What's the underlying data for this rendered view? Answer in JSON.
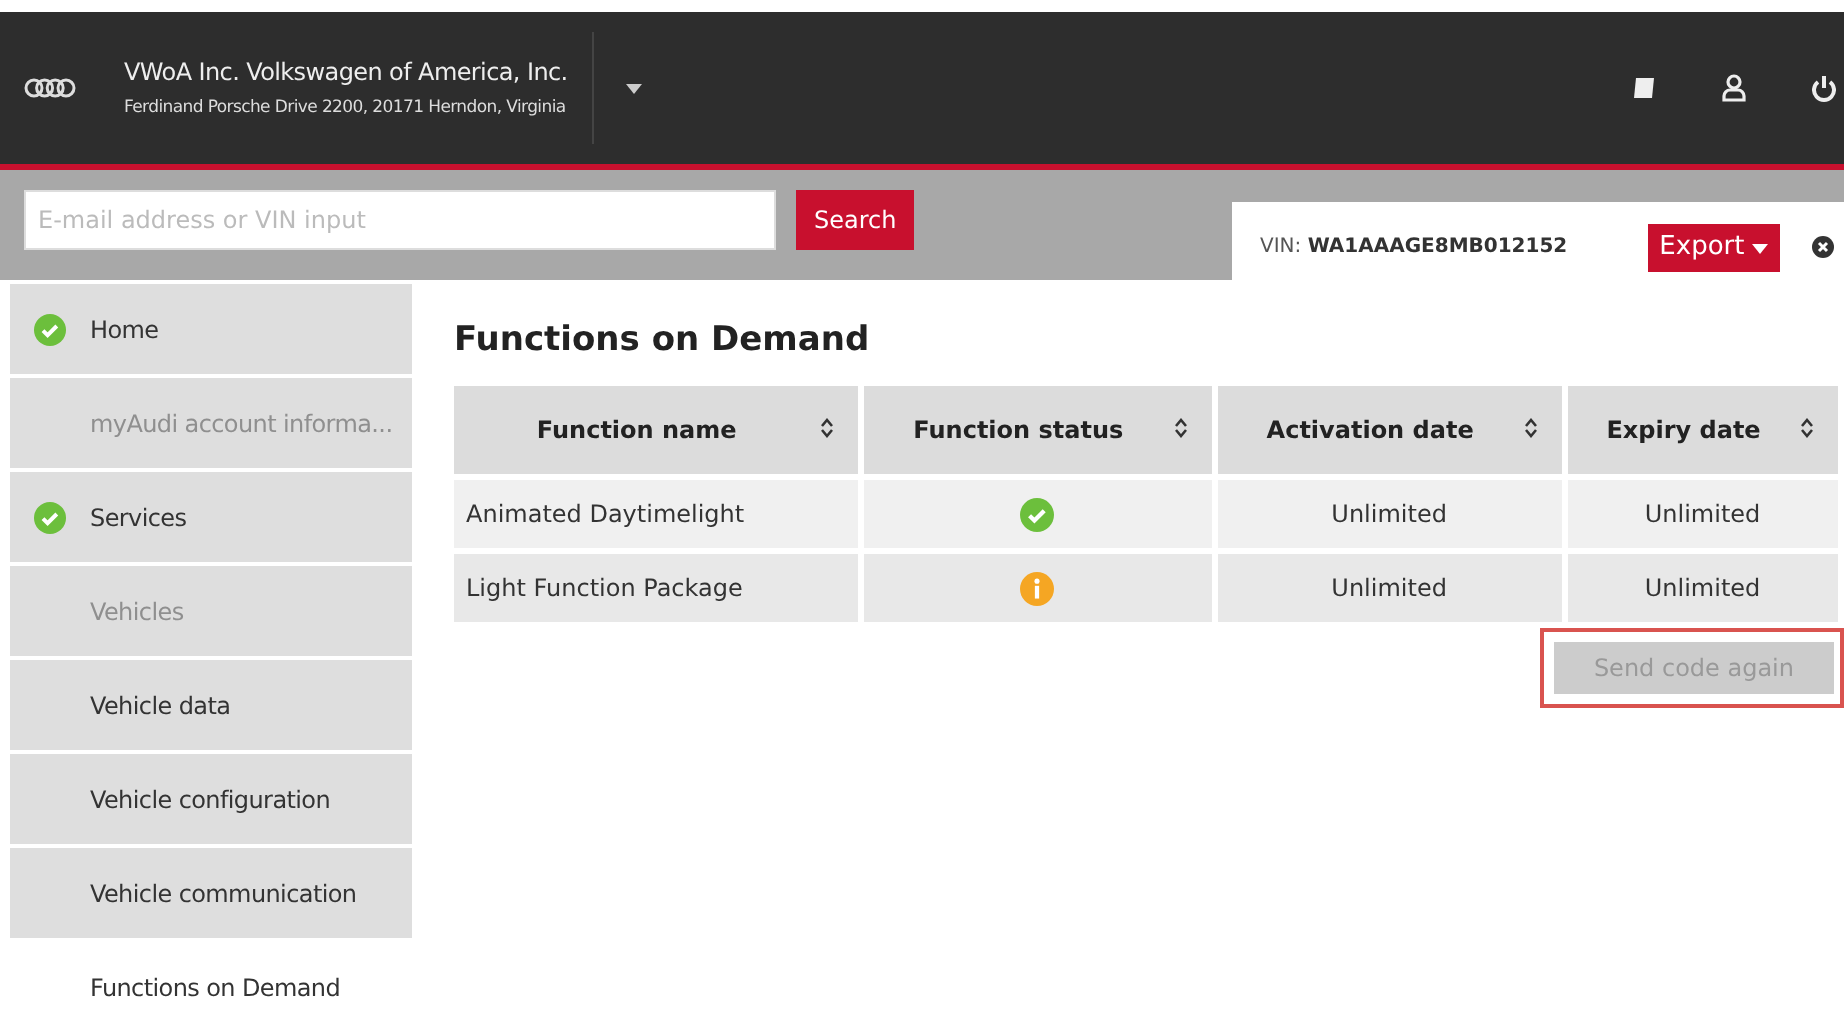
{
  "header": {
    "company": "VWoA Inc. Volkswagen of America, Inc.",
    "address": "Ferdinand Porsche Drive 2200, 20171 Herndon, Virginia"
  },
  "search": {
    "placeholder": "E-mail address or VIN input",
    "button": "Search"
  },
  "vin": {
    "label": "VIN:",
    "value": "WA1AAAGE8MB012152",
    "export": "Export"
  },
  "sidebar": {
    "items": [
      {
        "label": "Home",
        "checked": true,
        "disabled": false,
        "selected": false
      },
      {
        "label": "myAudi account informa...",
        "checked": false,
        "disabled": true,
        "selected": false
      },
      {
        "label": "Services",
        "checked": true,
        "disabled": false,
        "selected": false
      },
      {
        "label": "Vehicles",
        "checked": false,
        "disabled": true,
        "selected": false
      },
      {
        "label": "Vehicle data",
        "checked": false,
        "disabled": false,
        "selected": false
      },
      {
        "label": "Vehicle configuration",
        "checked": false,
        "disabled": false,
        "selected": false
      },
      {
        "label": "Vehicle communication",
        "checked": false,
        "disabled": false,
        "selected": false
      },
      {
        "label": "Functions on Demand",
        "checked": false,
        "disabled": false,
        "selected": true
      }
    ]
  },
  "page": {
    "title": "Functions on Demand"
  },
  "table": {
    "columns": [
      "Function name",
      "Function status",
      "Activation date",
      "Expiry date"
    ],
    "rows": [
      {
        "name": "Animated Daytimelight",
        "kind": "ok",
        "activation": "Unlimited",
        "expiry": "Unlimited"
      },
      {
        "name": "Light Function Package",
        "kind": "info",
        "activation": "Unlimited",
        "expiry": "Unlimited"
      }
    ]
  },
  "send_button": {
    "label": "Send code again",
    "disabled": true,
    "highlighted": true
  }
}
